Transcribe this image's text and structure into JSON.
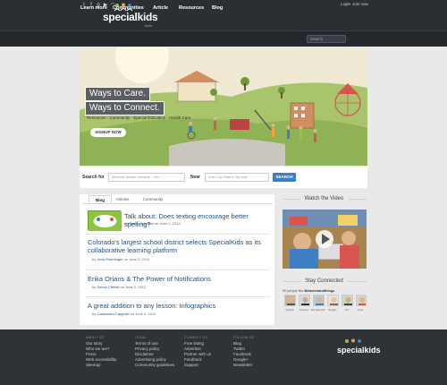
{
  "header": {
    "social": [
      "twitter-icon",
      "facebook-icon",
      "google-plus-icon",
      "youtube-icon",
      "rss-icon"
    ],
    "logo": "specialkids",
    "logo_sub": "beta",
    "login": "Login",
    "join": "Join now",
    "nav": [
      "Learn more",
      "Communities",
      "Article",
      "Resources",
      "Blog"
    ],
    "search_placeholder": "Search"
  },
  "hero": {
    "line1": "Ways to Care.",
    "line2": "Ways to Connect.",
    "tagline": "Resources · Community · Special Education · Health Care",
    "button": "SIGNUP NOW"
  },
  "search": {
    "for_label": "Search for",
    "for_placeholder": "keywords (autism, therapist ... etc)",
    "near_label": "Near",
    "near_placeholder": "Enter City, State or Zip code ...",
    "button": "SEARCH"
  },
  "tabs": [
    "Blog",
    "Articles",
    "Community"
  ],
  "posts": [
    {
      "title": "Talk about: Does texting encourage better spelling?",
      "by": "by",
      "author": "Simon Johnson",
      "date": "on June 2, 2012"
    },
    {
      "title": "Colorado's largest school district selects SpecialKids as its collaborative learning platform",
      "by": "by",
      "author": "Jerry Ensminger",
      "date": "on June 2, 2012"
    },
    {
      "title": "Erika Orians & The Power of Notifications",
      "by": "by",
      "author": "Sunny Clifford",
      "date": "on June 2, 2012"
    },
    {
      "title": "A great addition to any lesson: Infographics",
      "by": "by",
      "author": "Cassandra Cappello",
      "date": "on June 2, 2012"
    }
  ],
  "thumb_label": "word kids",
  "sidebar": {
    "video_title": "Watch the Video",
    "stay_title": "Stay Connected",
    "stay_count": "90 people like",
    "stay_brand": "Betweenandthings",
    "faces": [
      "Sophia",
      "Graham",
      "Ed Hammer",
      "Brigitte",
      "Tim",
      "Gina"
    ]
  },
  "footer": {
    "columns": [
      {
        "head": "ABOUT US",
        "links": [
          "Our story",
          "Who we are?",
          "Press",
          "Web accessibility",
          "Sitemap"
        ]
      },
      {
        "head": "LEGAL",
        "links": [
          "Terms of use",
          "Privacy policy",
          "Disclaimer",
          "Advertising policy",
          "Community guidelines"
        ]
      },
      {
        "head": "CONNECT US",
        "links": [
          "Free listing",
          "Advertise",
          "Partner with us",
          "Feedback",
          "Support"
        ]
      },
      {
        "head": "FOLLOW US",
        "links": [
          "Blog",
          "Twitter",
          "Facebook",
          "Google+",
          "Newsletter"
        ]
      }
    ],
    "logo": "specialkids"
  },
  "colors": {
    "accent": "#3e7fc4",
    "link": "#1f4f82",
    "topbar": "#2b2e33",
    "thumb": "#8cc63f",
    "footer": "#2f3337"
  }
}
